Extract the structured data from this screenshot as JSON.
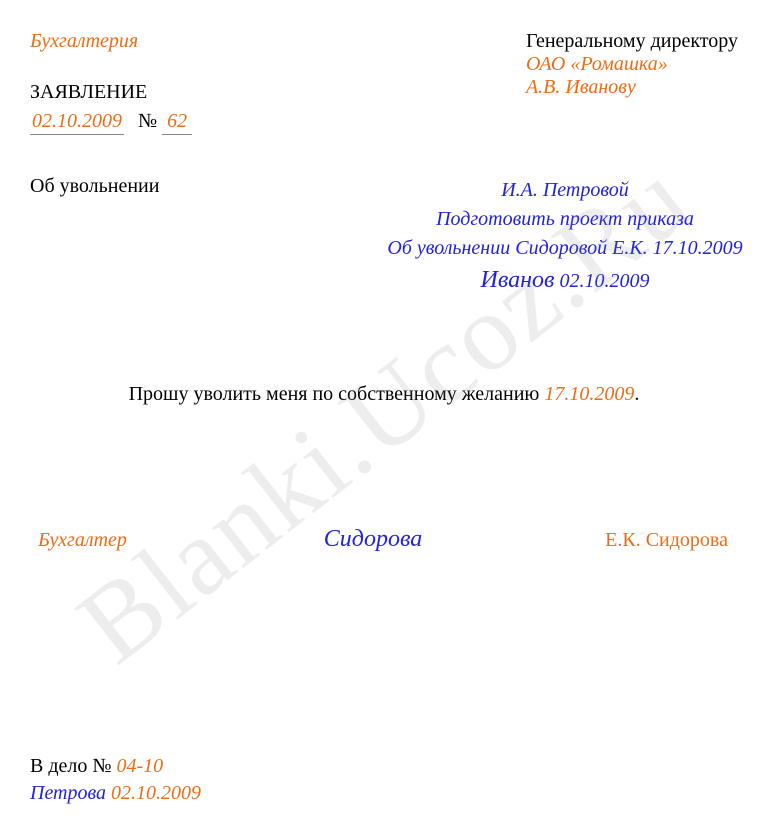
{
  "watermark": "Blanki.Ucoz.Ru",
  "header": {
    "department": "Бухгалтерия",
    "addressee_title": "Генеральному директору",
    "company": "ОАО «Ромашка»",
    "addressee_name": "А.В. Иванову"
  },
  "doc": {
    "title": "ЗАЯВЛЕНИЕ",
    "date": "02.10.2009",
    "number_label": "№",
    "number": "62",
    "subject": "Об увольнении"
  },
  "resolution": {
    "line1": "И.А. Петровой",
    "line2": "Подготовить проект приказа",
    "line3": "Об увольнении Сидоровой Е.К. 17.10.2009",
    "signature": "Иванов",
    "sig_date": "02.10.2009"
  },
  "body": {
    "text_before": "Прошу уволить меня по собственному желанию ",
    "date": "17.10.2009",
    "text_after": "."
  },
  "signature": {
    "role": "Бухгалтер",
    "sig": "Сидорова",
    "name": "Е.К. Сидорова"
  },
  "filing": {
    "label": "В дело № ",
    "number": "04-10",
    "sig": "Петрова",
    "date": "02.10.2009"
  }
}
